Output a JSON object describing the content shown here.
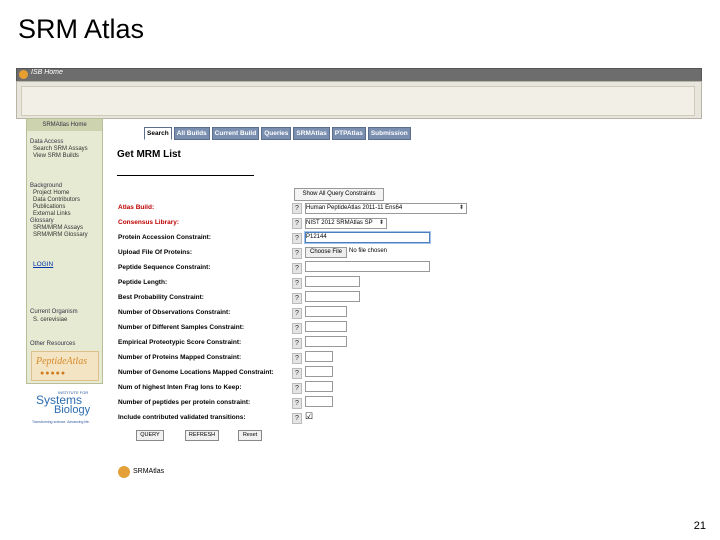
{
  "slide": {
    "title": "SRM Atlas",
    "page_number": "21"
  },
  "isb_bar": {
    "label": "ISB Home"
  },
  "sidebar": {
    "header": "SRMAtlas Home",
    "sections": [
      {
        "title": "Data Access",
        "items": [
          "Search SRM Assays",
          "View SRM Builds"
        ]
      },
      {
        "title": "Background",
        "items": [
          "Project Home",
          "Data Contributors",
          "Publications",
          "External Links"
        ]
      },
      {
        "title": "Glossary",
        "items": [
          "SRM/MRM Assays",
          "SRM/MRM Glossary"
        ]
      },
      {
        "title": "Current Organism",
        "items": [
          "S. cerevisiae"
        ]
      },
      {
        "title": "Other Resources",
        "items": []
      }
    ],
    "login": "LOGIN",
    "peptide_logo": "PeptideAtlas",
    "isb_logo": {
      "small": "INSTITUTE FOR",
      "line1": "Systems",
      "line2": "Biology",
      "tagline": "Transforming science. Advancing life."
    }
  },
  "tabs": [
    "Search",
    "All Builds",
    "Current Build",
    "Queries",
    "SRMAtlas",
    "PTPAtlas",
    "Submission"
  ],
  "page_title": "Get MRM List",
  "show_button": "Show All Query Constraints",
  "form": {
    "atlas_build": {
      "label": "Atlas Build:",
      "value": "Human PeptideAtlas 2011-11 Ens64"
    },
    "consensus_library": {
      "label": "Consensus Library:",
      "value": "NIST 2012 SRMAtlas SP"
    },
    "protein_accession": {
      "label": "Protein Accession Constraint:",
      "value": "P12144"
    },
    "upload_file": {
      "label": "Upload File Of Proteins:",
      "button": "Choose File",
      "status": "No file chosen"
    },
    "peptide_sequence": {
      "label": "Peptide Sequence Constraint:"
    },
    "peptide_length": {
      "label": "Peptide Length:"
    },
    "best_probability": {
      "label": "Best Probability Constraint:"
    },
    "num_observations": {
      "label": "Number of Observations Constraint:"
    },
    "num_samples": {
      "label": "Number of Different Samples Constraint:"
    },
    "empirical_score": {
      "label": "Empirical Proteotypic Score Constraint:"
    },
    "num_proteins": {
      "label": "Number of Proteins Mapped Constraint:"
    },
    "num_genome": {
      "label": "Number of Genome Locations Mapped Constraint:"
    },
    "num_highest": {
      "label": "Num of highest Inten Frag Ions to Keep:"
    },
    "num_peptides": {
      "label": "Number of peptides per protein constraint:"
    },
    "include_validated": {
      "label": "Include contributed validated transitions:"
    }
  },
  "buttons": {
    "query": "QUERY",
    "refresh": "REFRESH",
    "reset": "Reset"
  },
  "footer_logo": "SRMAtlas",
  "colors": {
    "required_label": "#c00000",
    "tab_bg": "#7a8fb0",
    "sidebar_bg": "#e6ead2",
    "accent_orange": "#e4a13a"
  }
}
